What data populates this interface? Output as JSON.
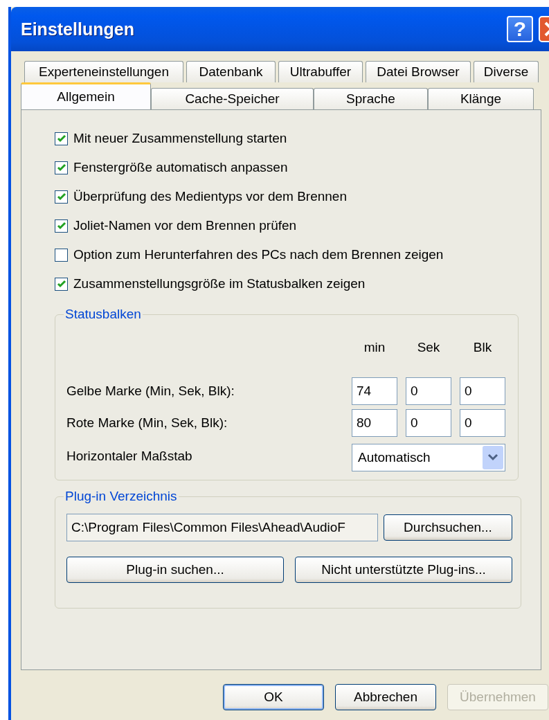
{
  "window": {
    "title": "Einstellungen",
    "help_button": "?"
  },
  "tab_rows": [
    [
      {
        "label": "Experteneinstellungen",
        "selected": false
      },
      {
        "label": "Datenbank",
        "selected": false
      },
      {
        "label": "Ultrabuffer",
        "selected": false
      },
      {
        "label": "Datei Browser",
        "selected": false
      },
      {
        "label": "Diverse",
        "selected": false
      }
    ],
    [
      {
        "label": "Allgemein",
        "selected": true
      },
      {
        "label": "Cache-Speicher",
        "selected": false
      },
      {
        "label": "Sprache",
        "selected": false
      },
      {
        "label": "Klänge",
        "selected": false
      }
    ]
  ],
  "options": [
    {
      "label": "Mit neuer Zusammenstellung starten",
      "checked": true
    },
    {
      "label": "Fenstergröße automatisch anpassen",
      "checked": true
    },
    {
      "label": "Überprüfung des Medientyps vor dem Brennen",
      "checked": true
    },
    {
      "label": "Joliet-Namen vor dem Brennen prüfen",
      "checked": true
    },
    {
      "label": "Option zum Herunterfahren des PCs nach dem Brennen zeigen",
      "checked": false
    },
    {
      "label": "Zusammenstellungsgröße im Statusbalken zeigen",
      "checked": true
    }
  ],
  "statusbalken": {
    "title": "Statusbalken",
    "columns": [
      "min",
      "Sek",
      "Blk"
    ],
    "rows": [
      {
        "label": "Gelbe Marke (Min, Sek, Blk):",
        "values": [
          "74",
          "0",
          "0"
        ]
      },
      {
        "label": "Rote Marke (Min, Sek, Blk):",
        "values": [
          "80",
          "0",
          "0"
        ]
      }
    ],
    "scale": {
      "label": "Horizontaler Maßstab",
      "value": "Automatisch"
    }
  },
  "plugin": {
    "title": "Plug-in Verzeichnis",
    "path": "C:\\Program Files\\Common Files\\Ahead\\AudioF",
    "browse": "Durchsuchen...",
    "buttons": [
      "Plug-in suchen...",
      "Nicht unterstützte Plug-ins..."
    ]
  },
  "buttons": [
    {
      "label": "OK",
      "default": true,
      "disabled": false
    },
    {
      "label": "Abbrechen",
      "default": false,
      "disabled": false
    },
    {
      "label": "Übernehmen",
      "default": false,
      "disabled": true
    }
  ]
}
